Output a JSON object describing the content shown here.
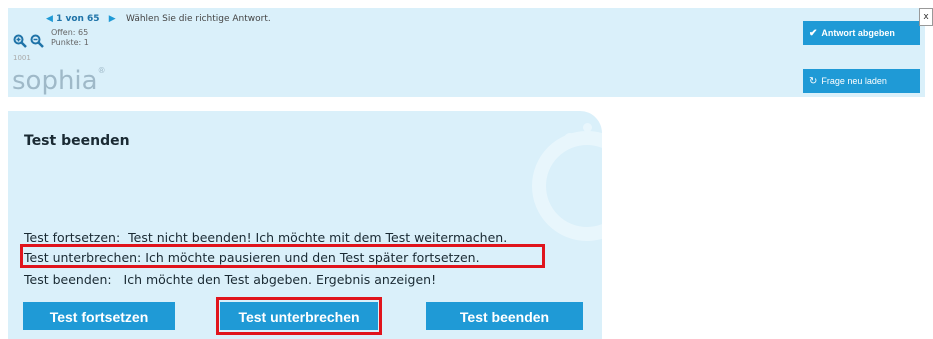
{
  "toolbar": {
    "nav_prev": "◀",
    "nav_position": "1 von 65",
    "nav_next": "▶",
    "instruction": "Wählen Sie die richtige Antwort.",
    "open_label": "Offen: 65",
    "points_label": "Punkte: 1",
    "question_id": "1001",
    "logo": "sophia",
    "logo_mark": "®",
    "submit_label": "Antwort abgeben",
    "submit_icon": "check-icon",
    "reload_label": "Frage neu laden",
    "reload_icon": "refresh-icon",
    "close_label": "x"
  },
  "dialog": {
    "title": "Test beenden",
    "options": [
      {
        "key": "Test fortsetzen:",
        "text": "Test nicht beenden! Ich möchte mit dem Test weitermachen."
      },
      {
        "key": "Test unterbrechen:",
        "text": "Ich möchte pausieren und den Test später fortsetzen."
      },
      {
        "key": "Test beenden:",
        "text": "Ich möchte den Test abgeben. Ergebnis anzeigen!"
      }
    ],
    "buttons": {
      "continue": "Test fortsetzen",
      "pause": "Test unterbrechen",
      "finish": "Test beenden"
    }
  },
  "colors": {
    "panel_bg": "#daf0fa",
    "button_bg": "#1f9ad6",
    "highlight": "#e0141c"
  }
}
